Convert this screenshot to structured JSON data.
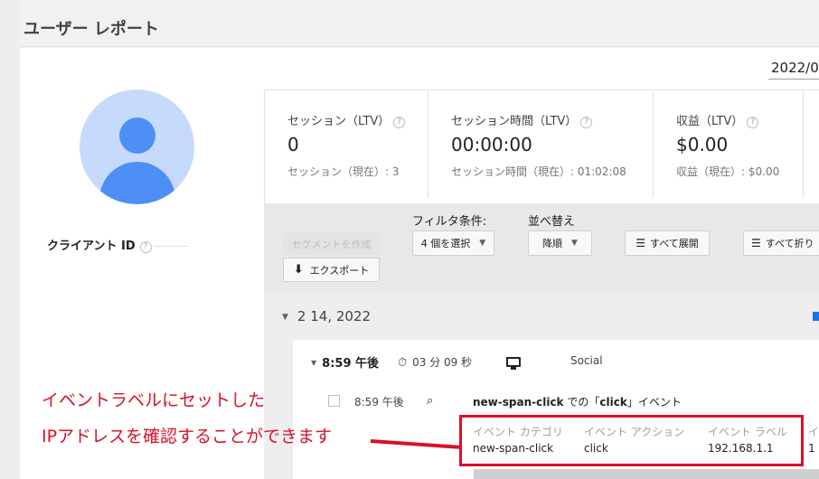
{
  "header": {
    "title": "ユーザー レポート",
    "date_range": "2022/0"
  },
  "profile": {
    "client_id_label": "クライアント ID",
    "help": "?"
  },
  "metrics": [
    {
      "label": "セッション（LTV）",
      "value": "0",
      "sub": "セッション（現在）: 3"
    },
    {
      "label": "セッション時間（LTV）",
      "value": "00:00:00",
      "sub": "セッション時間（現在）: 01:02:08"
    },
    {
      "label": "収益（LTV）",
      "value": "$0.00",
      "sub": "収益（現在）: $0.00"
    }
  ],
  "toolbar": {
    "create_segment": "セグメントを作成",
    "export": "エクスポート",
    "filter_label": "フィルタ条件:",
    "filter_value": "4 個を選択",
    "sort_label": "並べ替え",
    "sort_value": "降順",
    "expand_all": "すべて展開",
    "collapse_all": "すべて折り"
  },
  "timeline": {
    "date": "2 14, 2022",
    "session": {
      "time": "8:59 午後",
      "duration": "03 分 09 秒",
      "channel": "Social"
    },
    "event": {
      "time": "8:59 午後",
      "title_name": "new-span-click",
      "title_mid": " での「",
      "title_action": "click",
      "title_end": "」イベント",
      "columns": [
        {
          "header": "イベント カテゴリ",
          "value": "new-span-click"
        },
        {
          "header": "イベント アクション",
          "value": "click"
        },
        {
          "header": "イベント ラベル",
          "value": "192.168.1.1"
        },
        {
          "header": "イ",
          "value": "1"
        }
      ]
    }
  },
  "annotation": {
    "line1": "イベントラベルにセットした",
    "line2": "IPアドレスを確認することができます"
  },
  "colors": {
    "accent_red": "#d9102a",
    "avatar_bg": "#c6dafc",
    "avatar_fg": "#4e8ff5",
    "flag_blue": "#1a73e8"
  }
}
